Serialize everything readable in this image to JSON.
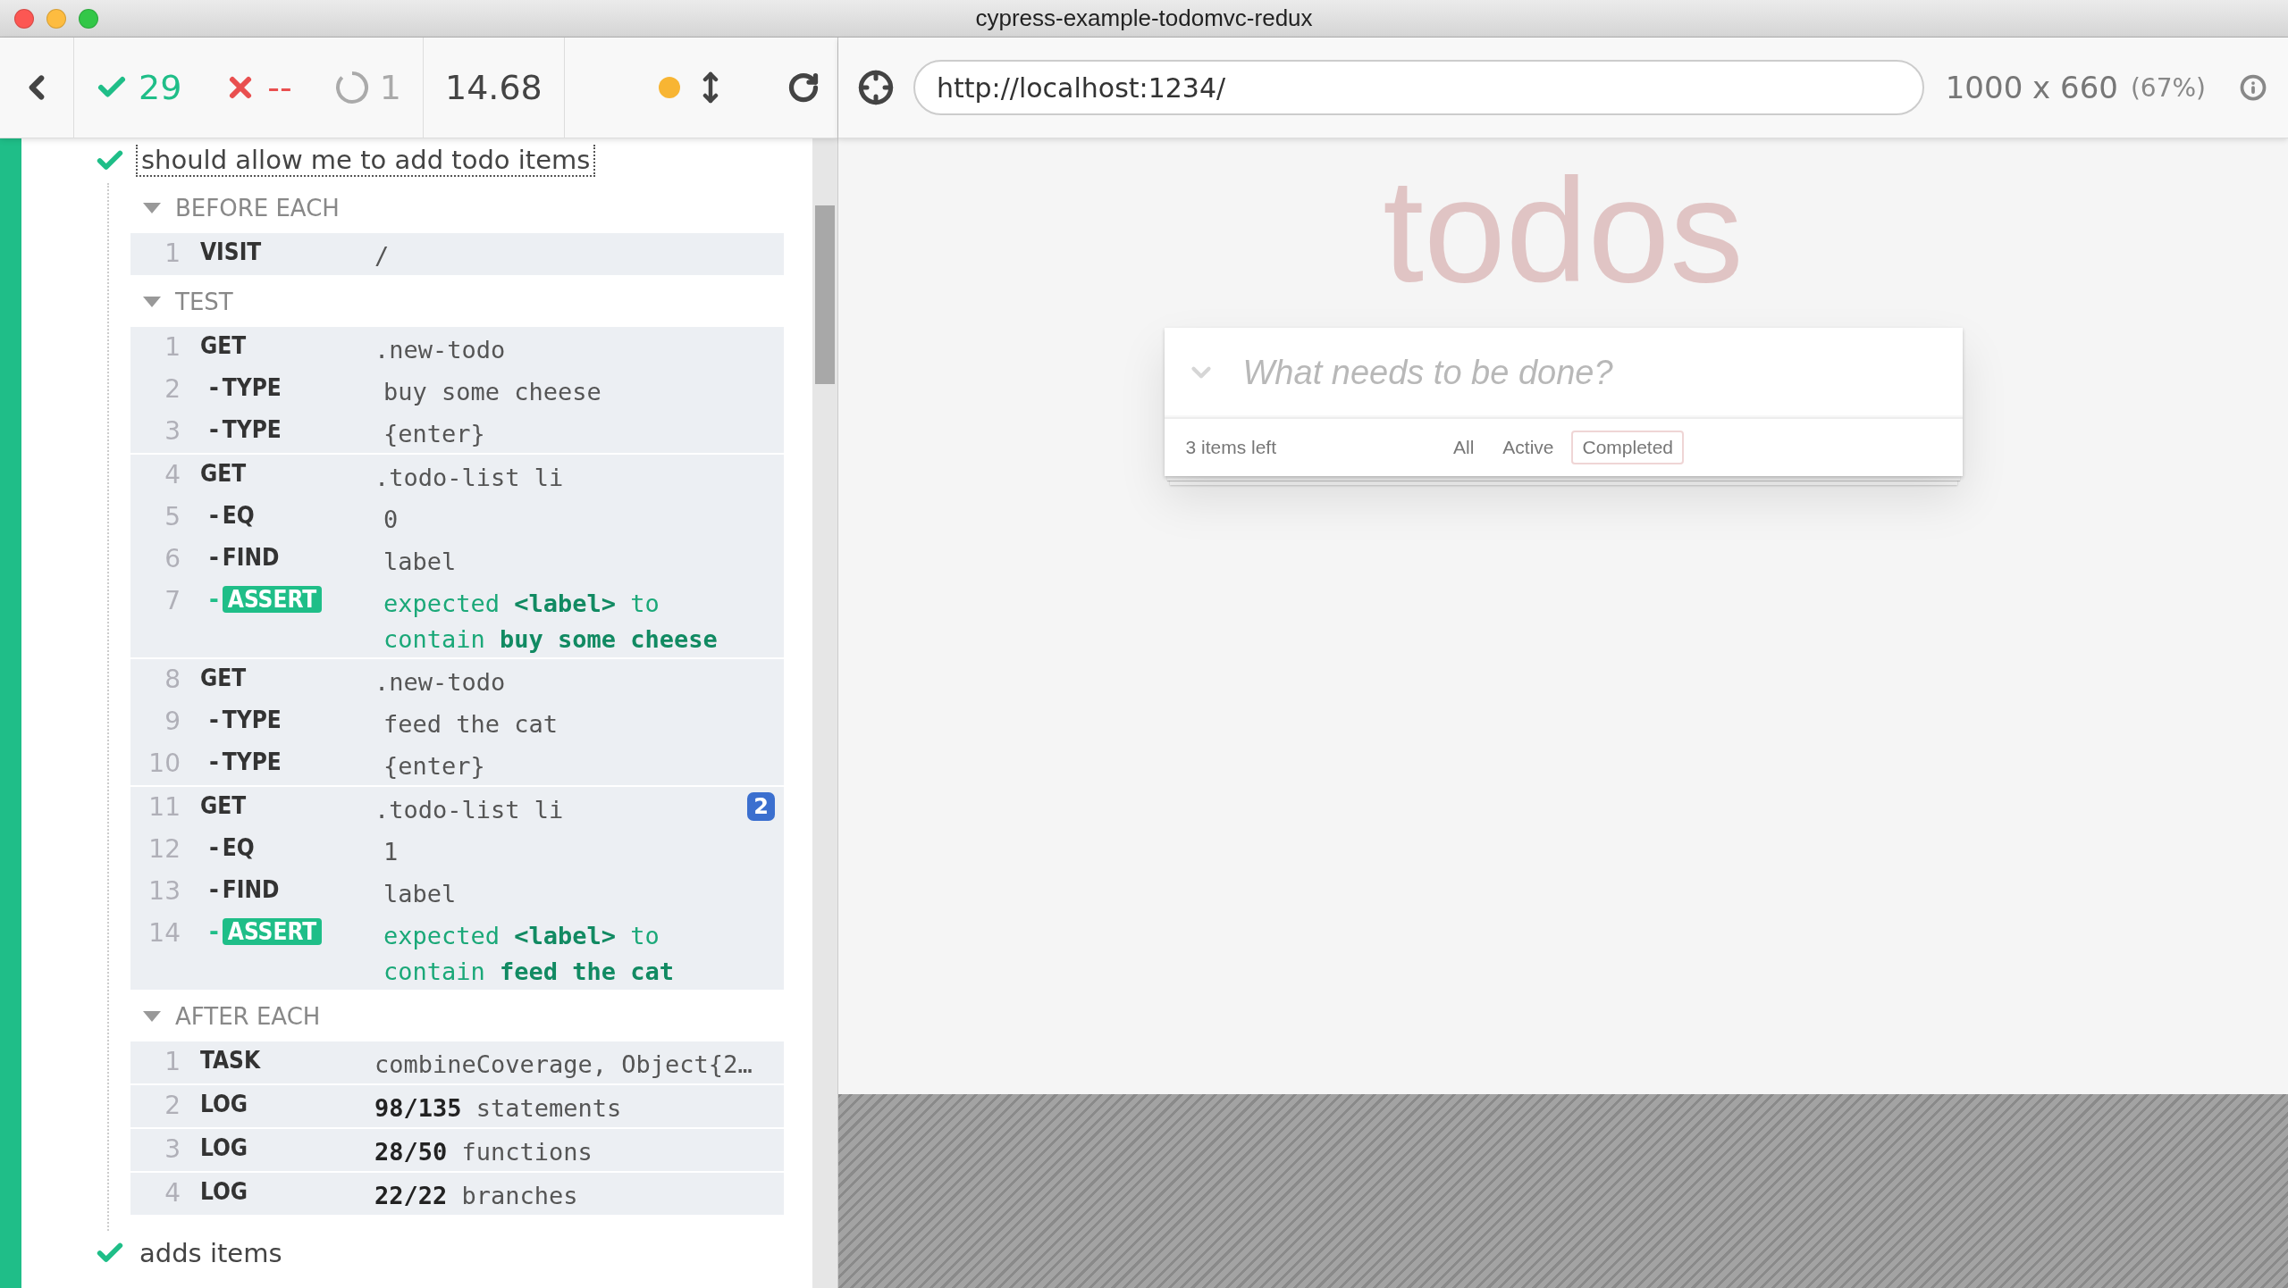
{
  "window": {
    "title": "cypress-example-todomvc-redux"
  },
  "toolbar": {
    "passed": "29",
    "failed": "--",
    "pending": "1",
    "duration": "14.68",
    "url": "http://localhost:1234/",
    "viewport": "1000 x 660",
    "scale": "(67%)"
  },
  "reporter": {
    "test": {
      "title": "should allow me to add todo items",
      "passed": true
    },
    "sections": [
      {
        "title": "BEFORE EACH",
        "expanded": true,
        "groups": [
          [
            {
              "number": "1",
              "kind": "command",
              "name": "VISIT",
              "message": "/"
            }
          ]
        ]
      },
      {
        "title": "TEST",
        "expanded": true,
        "groups": [
          [
            {
              "number": "1",
              "kind": "command",
              "name": "GET",
              "message": ".new-todo"
            },
            {
              "number": "2",
              "kind": "child",
              "prefix": "-",
              "name": "TYPE",
              "message": "buy some cheese"
            },
            {
              "number": "3",
              "kind": "child",
              "prefix": "-",
              "name": "TYPE",
              "message": "{enter}"
            }
          ],
          [
            {
              "number": "4",
              "kind": "command",
              "name": "GET",
              "message": ".todo-list li"
            },
            {
              "number": "5",
              "kind": "child",
              "prefix": "-",
              "name": "EQ",
              "message": "0"
            },
            {
              "number": "6",
              "kind": "child",
              "prefix": "-",
              "name": "FIND",
              "message": "label"
            },
            {
              "number": "7",
              "kind": "assert",
              "prefix": "-",
              "name": "ASSERT",
              "message": "expected **<label>** to contain **buy some cheese**"
            }
          ],
          [
            {
              "number": "8",
              "kind": "command",
              "name": "GET",
              "message": ".new-todo"
            },
            {
              "number": "9",
              "kind": "child",
              "prefix": "-",
              "name": "TYPE",
              "message": "feed the cat"
            },
            {
              "number": "10",
              "kind": "child",
              "prefix": "-",
              "name": "TYPE",
              "message": "{enter}"
            }
          ],
          [
            {
              "number": "11",
              "kind": "command",
              "name": "GET",
              "message": ".todo-list li",
              "badge": "2"
            },
            {
              "number": "12",
              "kind": "child",
              "prefix": "-",
              "name": "EQ",
              "message": "1"
            },
            {
              "number": "13",
              "kind": "child",
              "prefix": "-",
              "name": "FIND",
              "message": "label"
            },
            {
              "number": "14",
              "kind": "assert",
              "prefix": "-",
              "name": "ASSERT",
              "message": "expected **<label>** to contain **feed the cat**"
            }
          ]
        ]
      },
      {
        "title": "AFTER EACH",
        "expanded": true,
        "groups": [
          [
            {
              "number": "1",
              "kind": "command",
              "name": "TASK",
              "message": "combineCoverage, Object{2…"
            }
          ],
          [
            {
              "number": "2",
              "kind": "command",
              "name": "LOG",
              "message": "**98/135** statements"
            }
          ],
          [
            {
              "number": "3",
              "kind": "command",
              "name": "LOG",
              "message": "**28/50** functions"
            }
          ],
          [
            {
              "number": "4",
              "kind": "command",
              "name": "LOG",
              "message": "**22/22** branches"
            }
          ]
        ]
      }
    ],
    "next_test": {
      "title": "adds items",
      "passed": true
    }
  },
  "app": {
    "heading": "todos",
    "placeholder": "What needs to be done?",
    "items_left": "3 items left",
    "filters": [
      {
        "label": "All",
        "selected": false
      },
      {
        "label": "Active",
        "selected": false
      },
      {
        "label": "Completed",
        "selected": true
      }
    ]
  }
}
